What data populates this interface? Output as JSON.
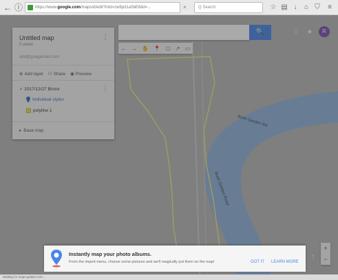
{
  "browser": {
    "url_prefix": "https://www.",
    "url_domain": "google.com",
    "url_path": "/maps/d/edit?mid=zw9pd1a5bE8&ll=...",
    "search_placeholder": "Q Search",
    "icons": [
      "back-arrow",
      "star",
      "bookmark",
      "download",
      "home",
      "shield",
      "menu"
    ]
  },
  "panel": {
    "title": "Untitled map",
    "views": "0 views",
    "email": "add@googlemail.com",
    "actions": [
      {
        "icon": "add-layer-icon",
        "label": "Add layer"
      },
      {
        "icon": "share-icon",
        "label": "Share"
      },
      {
        "icon": "preview-icon",
        "label": "Preview"
      }
    ],
    "layer_name": "2017/12/27 Bronx",
    "item1": "Individual styles",
    "item2": "polyline 1",
    "basemap": "Base map"
  },
  "toolbar": {
    "search_icon": "🔍",
    "tools": [
      "←",
      "→",
      "✋",
      "📍",
      "⬡",
      "↗",
      "▭"
    ]
  },
  "topright": {
    "avatar": "R"
  },
  "map_labels": {
    "river1": "Bush Garden Rd",
    "river2": "Bush Garden Road"
  },
  "banner": {
    "heading": "Instantly map your photo albums.",
    "body": "From the import menu, choose some pictures and we'll magically put them on the map!",
    "gotit": "GOT IT",
    "learn": "LEARN MORE"
  },
  "zoom": {
    "in": "+",
    "out": "−"
  },
  "help": "?",
  "status": "Waiting for maps.gstatic.com..."
}
